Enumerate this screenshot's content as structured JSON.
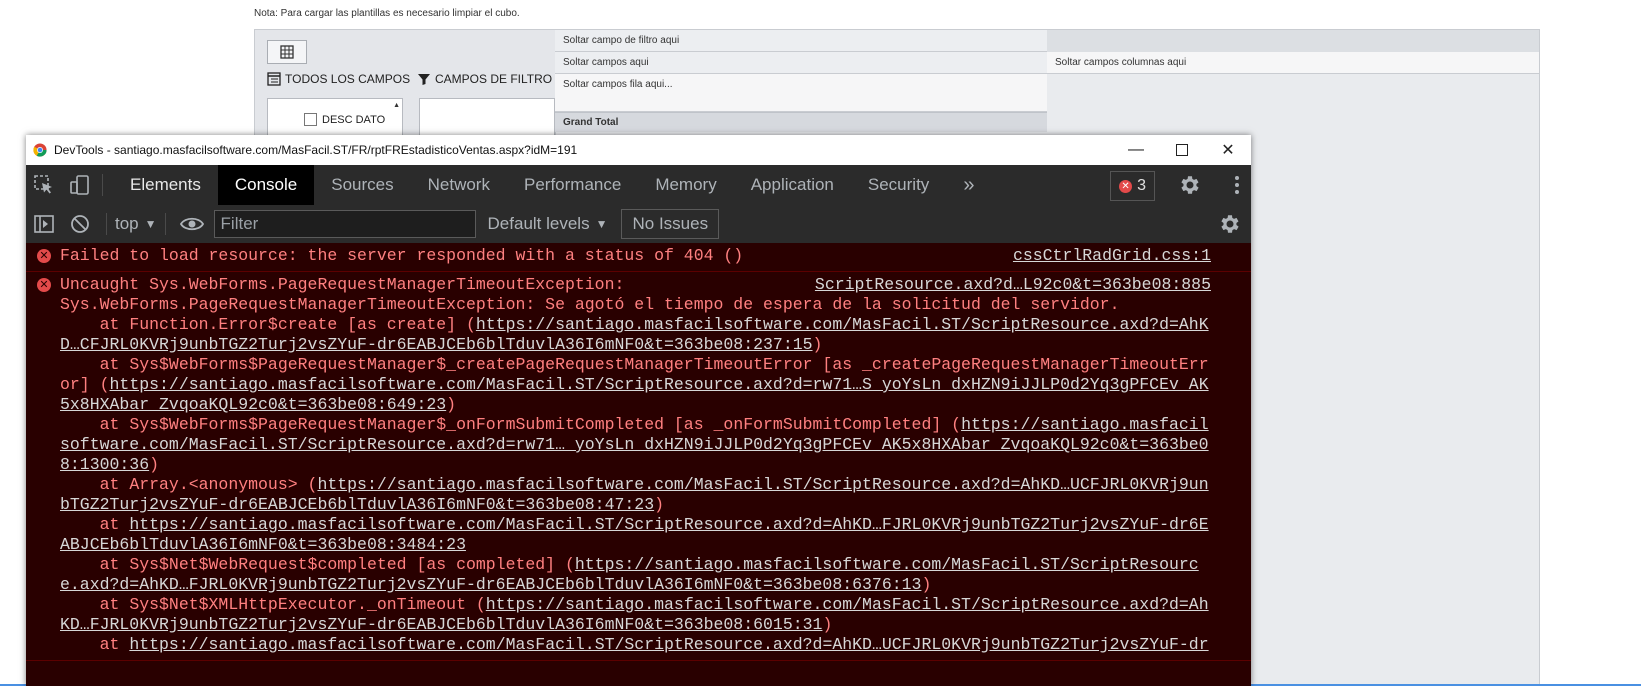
{
  "page": {
    "note": "Nota: Para cargar las plantillas es necesario limpiar el cubo.",
    "pivot": {
      "all_fields": "TODOS LOS CAMPOS",
      "filter_fields": "CAMPOS DE FILTRO",
      "field_item": "DESC DATO",
      "drop_filter": "Soltar campo de filtro aqui",
      "drop_data": "Soltar campos aqui",
      "drop_rows": "Soltar campos fila aqui...",
      "drop_columns": "Soltar campos columnas aqui",
      "grand_total": "Grand Total"
    }
  },
  "devtools": {
    "title": "DevTools - santiago.masfacilsoftware.com/MasFacil.ST/FR/rptFREstadisticoVentas.aspx?idM=191",
    "tabs": [
      "Elements",
      "Console",
      "Sources",
      "Network",
      "Performance",
      "Memory",
      "Application",
      "Security"
    ],
    "more_tabs": "»",
    "error_count": "3",
    "context": "top",
    "filter_placeholder": "Filter",
    "levels": "Default levels",
    "issues": "No Issues",
    "messages": [
      {
        "text": "Failed to load resource: the server responded with a status of 404 ()",
        "source": "cssCtrlRadGrid.css:1"
      },
      {
        "text": "Uncaught Sys.WebForms.PageRequestManagerTimeoutException:",
        "source": "ScriptResource.axd?d…L92c0&t=363be08:885",
        "detail": "Sys.WebForms.PageRequestManagerTimeoutException: Se agotó el tiempo de espera de la solicitud del servidor.",
        "stack": [
          {
            "pre": "    at Function.Error$create [as create] (",
            "url": "https://santiago.masfacilsoftware.com/MasFacil.ST/ScriptResource.axd?d=AhKD…CFJRL0KVRj9unbTGZ2Turj2vsZYuF-dr6EABJCEb6blTduvlA36I6mNF0&t=363be08:237:15",
            "post": ")"
          },
          {
            "pre": "    at Sys$WebForms$PageRequestManager$_createPageRequestManagerTimeoutError [as _createPageRequestManagerTimeoutError] (",
            "url": "https://santiago.masfacilsoftware.com/MasFacil.ST/ScriptResource.axd?d=rw71…S_yoYsLn_dxHZN9iJJLP0d2Yq3gPFCEv_AK5x8HXAbar_ZvqoaKQL92c0&t=363be08:649:23",
            "post": ")"
          },
          {
            "pre": "    at Sys$WebForms$PageRequestManager$_onFormSubmitCompleted [as _onFormSubmitCompleted] (",
            "url": "https://santiago.masfacilsoftware.com/MasFacil.ST/ScriptResource.axd?d=rw71…_yoYsLn_dxHZN9iJJLP0d2Yq3gPFCEv_AK5x8HXAbar_ZvqoaKQL92c0&t=363be08:1300:36",
            "post": ")"
          },
          {
            "pre": "    at Array.<anonymous> (",
            "url": "https://santiago.masfacilsoftware.com/MasFacil.ST/ScriptResource.axd?d=AhKD…UCFJRL0KVRj9unbTGZ2Turj2vsZYuF-dr6EABJCEb6blTduvlA36I6mNF0&t=363be08:47:23",
            "post": ")"
          },
          {
            "pre": "    at ",
            "url": "https://santiago.masfacilsoftware.com/MasFacil.ST/ScriptResource.axd?d=AhKD…FJRL0KVRj9unbTGZ2Turj2vsZYuF-dr6EABJCEb6blTduvlA36I6mNF0&t=363be08:3484:23",
            "post": ""
          },
          {
            "pre": "    at Sys$Net$WebRequest$completed [as completed] (",
            "url": "https://santiago.masfacilsoftware.com/MasFacil.ST/ScriptResource.axd?d=AhKD…FJRL0KVRj9unbTGZ2Turj2vsZYuF-dr6EABJCEb6blTduvlA36I6mNF0&t=363be08:6376:13",
            "post": ")"
          },
          {
            "pre": "    at Sys$Net$XMLHttpExecutor._onTimeout (",
            "url": "https://santiago.masfacilsoftware.com/MasFacil.ST/ScriptResource.axd?d=AhKD…FJRL0KVRj9unbTGZ2Turj2vsZYuF-dr6EABJCEb6blTduvlA36I6mNF0&t=363be08:6015:31",
            "post": ")"
          },
          {
            "pre": "    at ",
            "url": "https://santiago.masfacilsoftware.com/MasFacil.ST/ScriptResource.axd?d=AhKD…UCFJRL0KVRj9unbTGZ2Turj2vsZYuF-dr",
            "post": ""
          }
        ]
      }
    ]
  },
  "colors": {
    "console_bg": "#290000",
    "error_text": "#ff8080",
    "active_tab_bg": "#000000",
    "error_icon": "#e34a4a"
  }
}
